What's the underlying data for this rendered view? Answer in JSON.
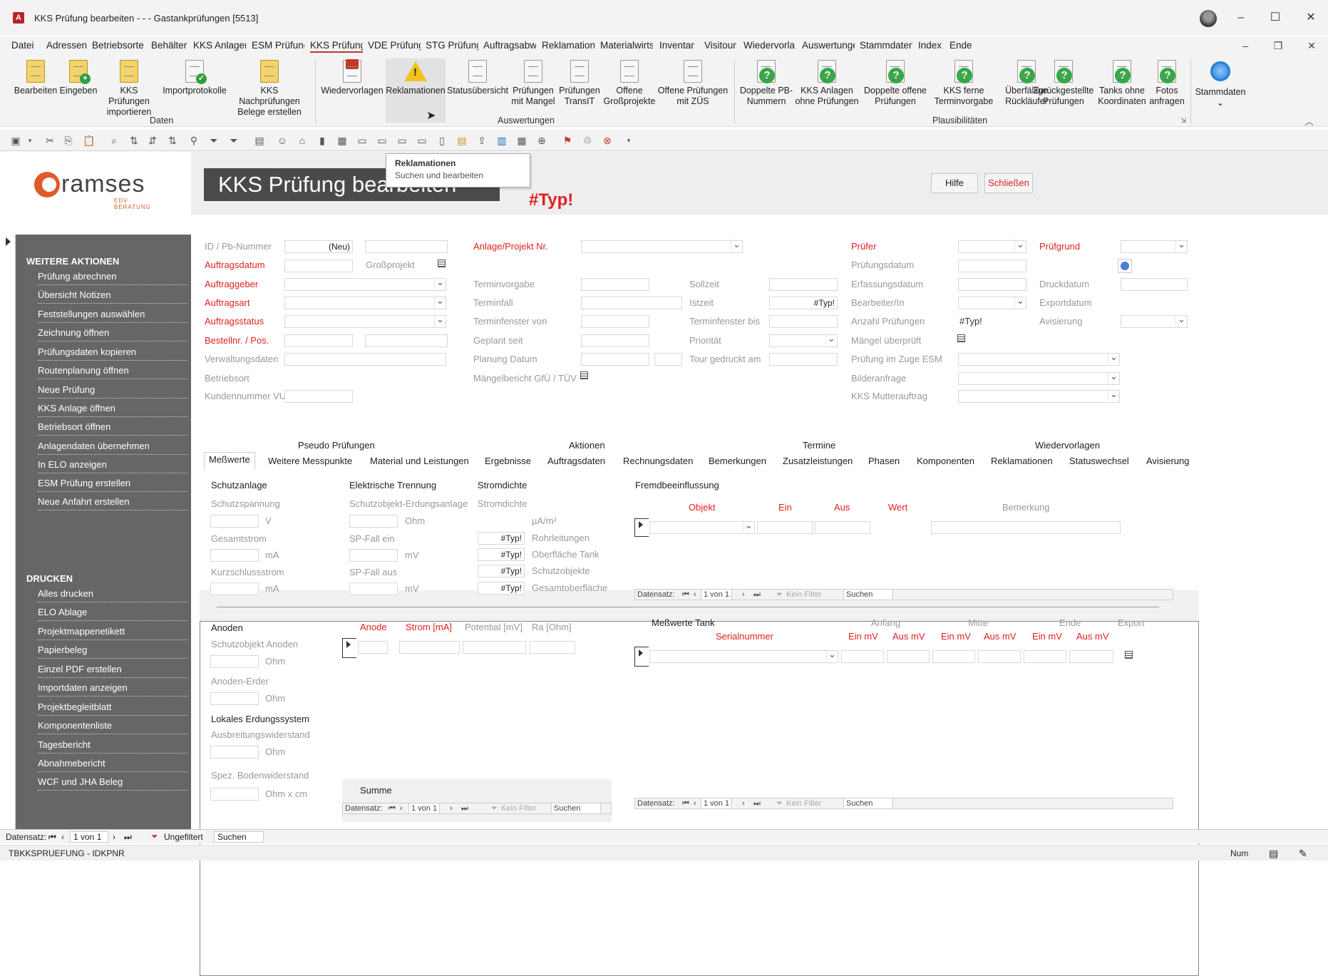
{
  "window": {
    "app_icon": "A",
    "title": "KKS Prüfung bearbeiten -  -  - Gastankprüfungen [5513]"
  },
  "menu": [
    "Datei",
    "Adressen",
    "Betriebsorte",
    "Behälter",
    "KKS Anlager",
    "ESM Prüfung",
    "KKS Prüfung",
    "VDE Prüfung",
    "STG Prüfung",
    "Auftragsabw",
    "Reklamation",
    "Materialwirts",
    "Inventar",
    "Visitour",
    "Wiedervorla",
    "Auswertunge",
    "Stammdaten",
    "Index",
    "Ende"
  ],
  "ribbon": {
    "daten": {
      "label": "Daten",
      "buttons": [
        {
          "l1": "Bearbeiten",
          "l2": ""
        },
        {
          "l1": "Eingeben",
          "l2": ""
        },
        {
          "l1": "KKS Prüfungen",
          "l2": "importieren"
        },
        {
          "l1": "Importprotokolle",
          "l2": ""
        },
        {
          "l1": "KKS Nachprüfungen",
          "l2": "Belege erstellen"
        }
      ]
    },
    "auswertungen": {
      "label": "Auswertungen",
      "buttons": [
        {
          "l1": "Wiedervorlagen",
          "l2": ""
        },
        {
          "l1": "Reklamationen",
          "l2": ""
        },
        {
          "l1": "Statusübersicht",
          "l2": ""
        },
        {
          "l1": "Prüfungen",
          "l2": "mit Mangel"
        },
        {
          "l1": "Prüfungen",
          "l2": "TransIT"
        },
        {
          "l1": "Offene",
          "l2": "Großprojekte"
        },
        {
          "l1": "Offene Prüfungen",
          "l2": "mit ZÜS"
        }
      ]
    },
    "plausi": {
      "label": "Plausibilitäten",
      "buttons": [
        {
          "l1": "Doppelte PB-",
          "l2": "Nummern"
        },
        {
          "l1": "KKS Anlagen",
          "l2": "ohne Prüfungen"
        },
        {
          "l1": "Doppelte offene",
          "l2": "Prüfungen"
        },
        {
          "l1": "KKS ferne",
          "l2": "Terminvorgabe"
        },
        {
          "l1": "Überfällige",
          "l2": "Rückläufer"
        },
        {
          "l1": "Zurückgestellte",
          "l2": "Prüfungen"
        },
        {
          "l1": "Tanks ohne",
          "l2": "Koordinaten"
        },
        {
          "l1": "Fotos",
          "l2": "anfragen"
        }
      ]
    },
    "stamm": {
      "l1": "Stammdaten",
      "l2": "⌄"
    }
  },
  "tooltip": {
    "title": "Reklamationen",
    "text": "Suchen und bearbeiten"
  },
  "header": {
    "logo_text": "ramses",
    "logo_sub": "EDV BERATUNG",
    "title": "KKS Prüfung bearbeiten",
    "typ": "#Typ!",
    "help": "Hilfe",
    "close": "Schließen"
  },
  "sidebar": {
    "section1": "WEITERE AKTIONEN",
    "items1": [
      "Prüfung abrechnen",
      "Übersicht Notizen",
      "Feststellungen auswählen",
      "Zeichnung öffnen",
      "Prüfungsdaten kopieren",
      "Routenplanung öffnen",
      "Neue Prüfung",
      "KKS Anlage öffnen",
      "Betriebsort öffnen",
      "Anlagendaten übernehmen",
      "In ELO anzeigen",
      "ESM Prüfung erstellen",
      "Neue Anfahrt erstellen"
    ],
    "section2": "DRUCKEN",
    "items2": [
      "Alles drucken",
      "ELO Ablage",
      "Projektmappenetikett",
      "Papierbeleg",
      "Einzel PDF erstellen",
      "Importdaten anzeigen",
      "Projektbegleitblatt",
      "Komponentenliste",
      "Tagesbericht",
      "Abnahmebericht",
      "WCF und JHA Beleg"
    ]
  },
  "form": {
    "id": "ID / Pb-Nummer",
    "neu": "(Neu)",
    "auftragsdatum": "Auftragsdatum",
    "grossprojekt": "Großprojekt",
    "auftraggeber": "Auftraggeber",
    "auftragsart": "Auftragsart",
    "auftragsstatus": "Auftragsstatus",
    "bestellnr": "Bestellnr. / Pos.",
    "verwaltung": "Verwaltungsdaten",
    "betriebsort": "Betriebsort",
    "kundennr": "Kundennummer VU",
    "anlage": "Anlage/Projekt Nr.",
    "terminvorgabe": "Terminvorgabe",
    "terminfall": "Terminfall",
    "tfvon": "Terminfenster von",
    "geplant": "Geplant seit",
    "planung": "Planung Datum",
    "maengelbericht": "Mängelbericht GfÜ / TÜV",
    "sollzeit": "Sollzeit",
    "istzeit": "Istzeit",
    "istzeit_val": "#Typ!",
    "tfbis": "Terminfenster bis",
    "prioritaet": "Priorität",
    "tour": "Tour gedruckt am",
    "pruefer": "Prüfer",
    "pruefungsdatum": "Prüfungsdatum",
    "erfassung": "Erfassungsdatum",
    "bearbeiter": "Bearbeiter/In",
    "anzahl": "Anzahl Prüfungen",
    "anzahl_val": "#Typ!",
    "maengel": "Mängel überprüft",
    "esm": "Prüfung im Zuge ESM",
    "bildanfrage": "Bilderanfrage",
    "mutter": "KKS Mutterauftrag",
    "pruefgrund": "Prüfgrund",
    "druckdatum": "Druckdatum",
    "exportdatum": "Exportdatum",
    "avisierung": "Avisierung"
  },
  "tabs": {
    "groups": [
      "Pseudo Prüfungen",
      "Aktionen",
      "Termine",
      "Wiedervorlagen"
    ],
    "items": [
      "Meßwerte",
      "Weitere Messpunkte",
      "Material und Leistungen",
      "Ergebnisse",
      "Auftragsdaten",
      "Rechnungsdaten",
      "Bemerkungen",
      "Zusatzleistungen",
      "Phasen",
      "Komponenten",
      "Reklamationen",
      "Statuswechsel",
      "Avisierung"
    ]
  },
  "mess": {
    "schutzanlage": "Schutzanlage",
    "schutzspannung": "Schutzspannung",
    "v": "V",
    "gesamtstrom": "Gesamtstrom",
    "ma": "mA",
    "kurzschluss": "Kurzschlussstrom",
    "trennung": "Elektrische Trennung",
    "erdungsanlage": "Schutzobjekt-Erdungsanlage",
    "ohm": "Ohm",
    "spein": "SP-Fall ein",
    "mv": "mV",
    "spaus": "SP-Fall aus",
    "stromdichte": "Stromdichte",
    "stromdichte2": "Stromdichte",
    "uam": "µA/m²",
    "typ": "#Typ!",
    "rohr": "Rohrleitungen",
    "tank": "Oberfläche Tank",
    "schutzobj": "Schutzobjekte",
    "gesamtob": "Gesamtoberfläche",
    "fremd": "Fremdbeeinflussung",
    "objekt": "Objekt",
    "ein": "Ein",
    "aus": "Aus",
    "wert": "Wert",
    "bemerkung": "Bemerkung",
    "anoden": "Anoden",
    "schutzanoden": "Schutzobjekt Anoden",
    "anodenerder": "Anoden-Erder",
    "lokal": "Lokales Erdungssystem",
    "ausbreitung": "Ausbreitungswiderstand",
    "boden": "Spez. Bodenwiderstand",
    "ohmxcm": "Ohm x cm",
    "anode": "Anode",
    "strom": "Strom [mA]",
    "potential": "Potential [mV]",
    "ra": "Ra [Ohm]",
    "summe": "Summe",
    "tank_title": "Meßwerte Tank",
    "serial": "Serialnummer",
    "anfang": "Anfang",
    "mitte": "Mitte",
    "ende": "Ende",
    "export": "Export",
    "einmv": "Ein mV",
    "ausmv": "Aus mV"
  },
  "nav": {
    "datensatz": "Datensatz:",
    "pos": "1 von 1",
    "kein": "Kein Filter",
    "suchen": "Suchen",
    "ungefiltert": "Ungefiltert"
  },
  "status": {
    "left": "TBKKSPRUEFUNG - IDKPNR",
    "num": "Num"
  }
}
